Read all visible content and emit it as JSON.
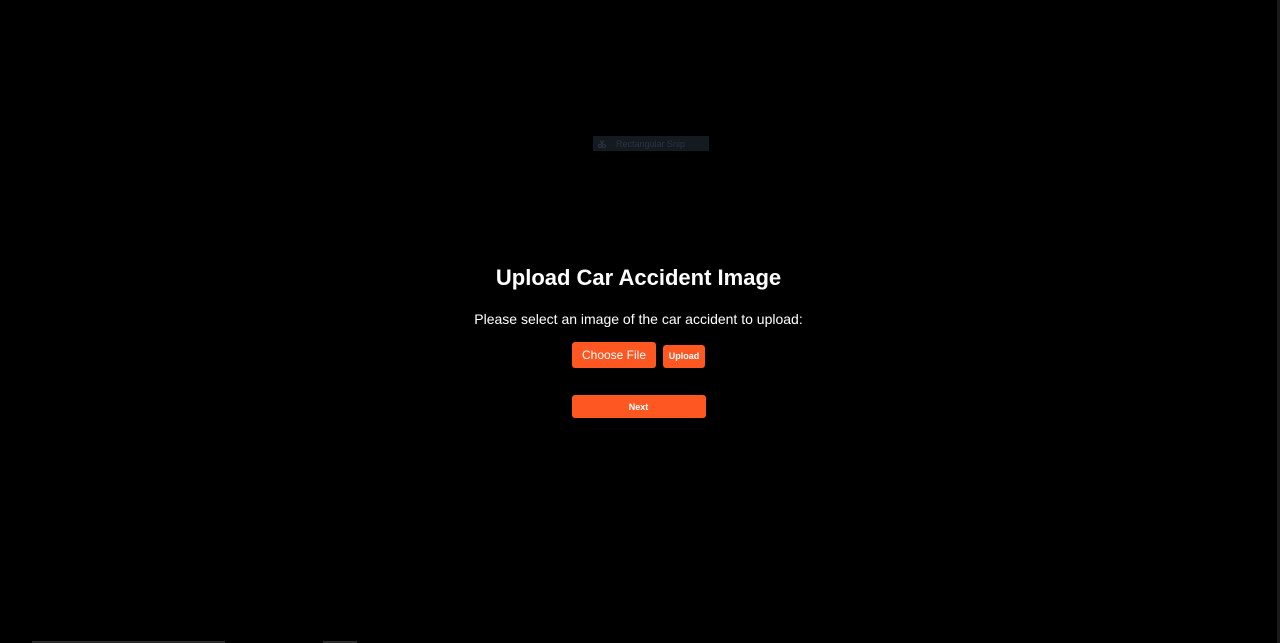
{
  "snip_tool": {
    "label": "Rectangular Snip",
    "icon": "scissors-icon"
  },
  "upload_form": {
    "title": "Upload Car Accident Image",
    "instructions": "Please select an image of the car accident to upload:",
    "choose_file_label": "Choose File",
    "upload_label": "Upload",
    "next_label": "Next"
  },
  "colors": {
    "background": "#000000",
    "accent": "#ff5722",
    "text": "#ffffff"
  }
}
